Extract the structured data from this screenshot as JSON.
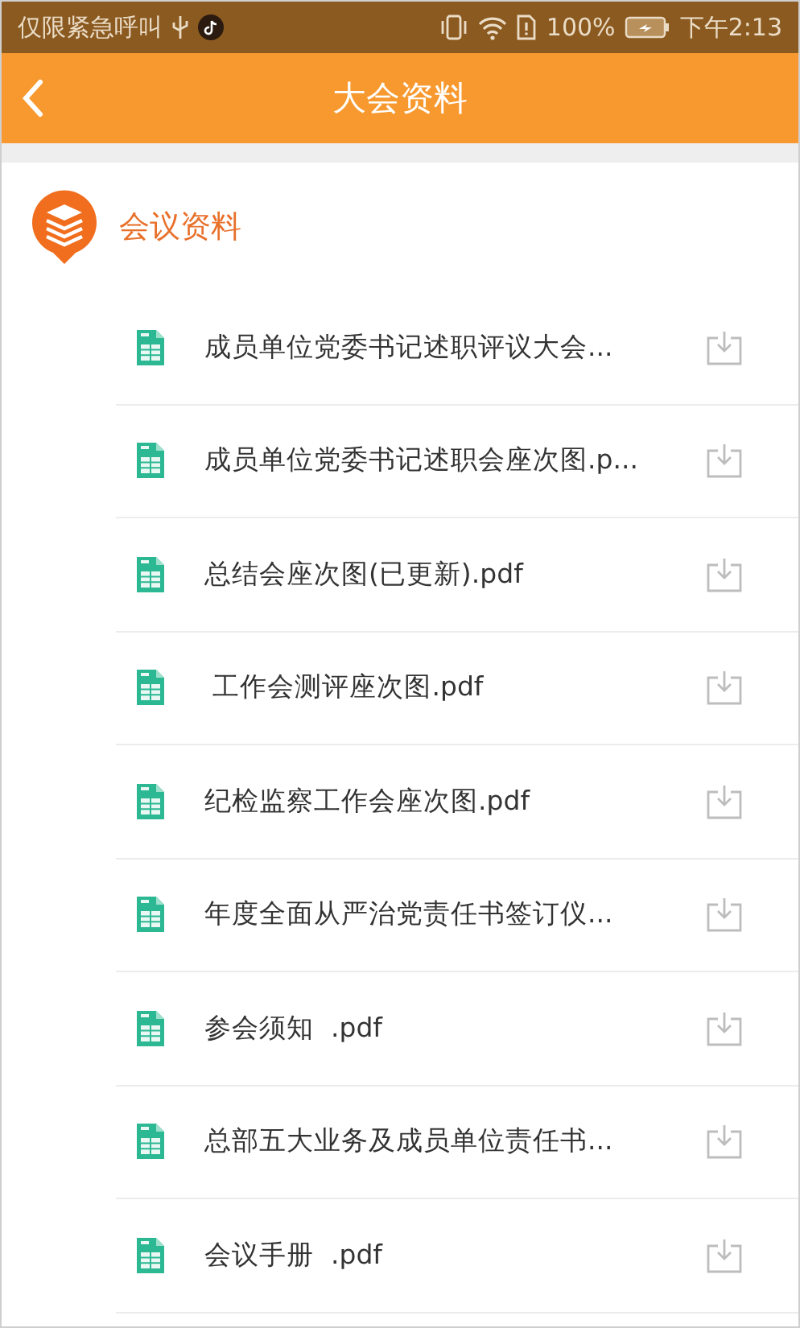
{
  "status_bar": {
    "carrier": "仅限紧急呼叫",
    "battery": "100%",
    "time": "下午2:13"
  },
  "header": {
    "title": "大会资料"
  },
  "section": {
    "title": "会议资料"
  },
  "files": [
    {
      "name": "成员单位党委书记述职评议大会..."
    },
    {
      "name": "成员单位党委书记述职会座次图.p..."
    },
    {
      "name": "总结会座次图(已更新).pdf"
    },
    {
      "name": " 工作会测评座次图.pdf"
    },
    {
      "name": "纪检监察工作会座次图.pdf"
    },
    {
      "name": "年度全面从严治党责任书签订仪..."
    },
    {
      "name": "参会须知  .pdf"
    },
    {
      "name": "总部五大业务及成员单位责任书..."
    },
    {
      "name": "会议手册  .pdf"
    }
  ]
}
